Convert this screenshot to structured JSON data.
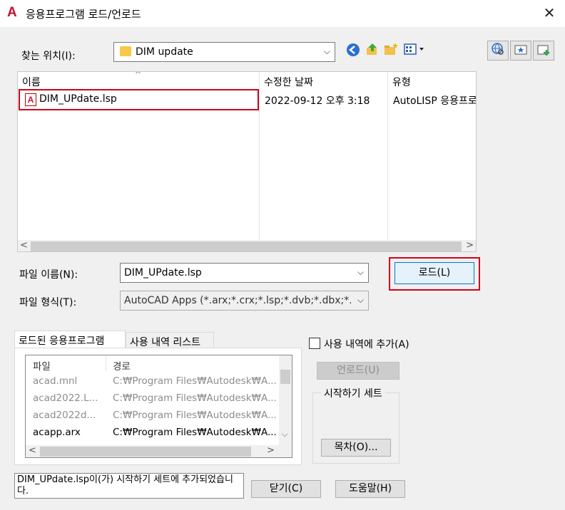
{
  "window": {
    "title": "응용프로그램 로드/언로드",
    "icon": "autocad-a-icon",
    "close_glyph": "✕"
  },
  "lookin": {
    "label": "찾는 위치(I):",
    "value": "DIM update",
    "arrow": "⌵"
  },
  "filelist": {
    "sort_caret": "^",
    "columns": [
      "이름",
      "수정한 날짜",
      "유형"
    ],
    "rows": [
      {
        "name": "DIM_UPdate.lsp",
        "modified": "2022-09-12 오후 3:18",
        "type": "AutoLISP 응용프로그램"
      }
    ],
    "scroll_left": "<",
    "scroll_right": ">"
  },
  "filename": {
    "label": "파일 이름(N):",
    "value": "DIM_UPdate.lsp",
    "arrow": "⌵"
  },
  "filetype": {
    "label": "파일 형식(T):",
    "value": "AutoCAD Apps (*.arx;*.crx;*.lsp;*.dvb;*.dbx;*.vlx;*.",
    "arrow": "⌵"
  },
  "buttons": {
    "load": "로드(L)",
    "unload": "언로드(U)",
    "contents": "목차(O)...",
    "close": "닫기(C)",
    "help": "도움말(H)"
  },
  "tabs": {
    "loaded": "로드된 응용프로그램",
    "history": "사용 내역 리스트"
  },
  "loaded_list": {
    "columns": [
      "파일",
      "경로"
    ],
    "rows": [
      {
        "file": "acad.mnl",
        "path": "C:₩Program Files₩Autodesk₩A...",
        "dimmed": true
      },
      {
        "file": "acad2022.L...",
        "path": "C:₩Program Files₩Autodesk₩A...",
        "dimmed": true
      },
      {
        "file": "acad2022d...",
        "path": "C:₩Program Files₩Autodesk₩A...",
        "dimmed": true
      },
      {
        "file": "acapp.arx",
        "path": "C:₩Program Files₩Autodesk₩A...",
        "dimmed": false
      }
    ],
    "scroll_left": "<",
    "scroll_right": ">",
    "scroll_down": "⌵"
  },
  "add_history": {
    "label": "사용 내역에 추가(A)",
    "checked": false
  },
  "startup_suite": {
    "label": "시작하기 세트"
  },
  "status": {
    "message": "DIM_UPdate.lsp이(가) 시작하기 세트에 추가되었습니다."
  },
  "toolbar": {
    "back": "back-icon",
    "up": "up-folder-icon",
    "new_folder": "new-folder-icon",
    "views": "views-menu-icon",
    "web": "search-web-icon",
    "favorites": "favorites-icon",
    "add_favorite": "add-to-favorites-icon"
  },
  "colors": {
    "highlight_red": "#d0021b",
    "accent_blue": "#0078d7",
    "app_red": "#c8102e"
  }
}
